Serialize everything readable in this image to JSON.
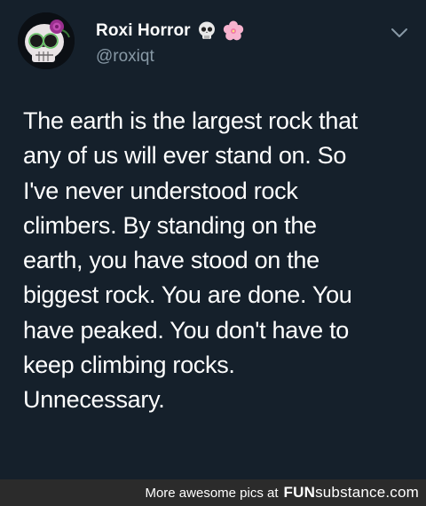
{
  "tweet": {
    "display_name": "Roxi Horror",
    "handle": "@roxiqt",
    "name_emojis": [
      "skull-emoji",
      "cherry-blossom-emoji"
    ],
    "text": "The earth is the largest rock that\nany of us will ever stand on. So\nI've never understood rock\nclimbers. By standing on the\nearth, you have stood on the\nbiggest rock. You are done. You\nhave peaked. You don't have to\nkeep climbing rocks.\nUnnecessary.",
    "menu_icon": "chevron-down-icon"
  },
  "watermark": {
    "prefix": "More awesome pics at",
    "brand_bold": "FUN",
    "brand_rest": "substance.com"
  },
  "colors": {
    "background": "#15202b",
    "text_primary": "#ffffff",
    "text_secondary": "#8899a6",
    "footer_bg": "#2b2b2b"
  }
}
